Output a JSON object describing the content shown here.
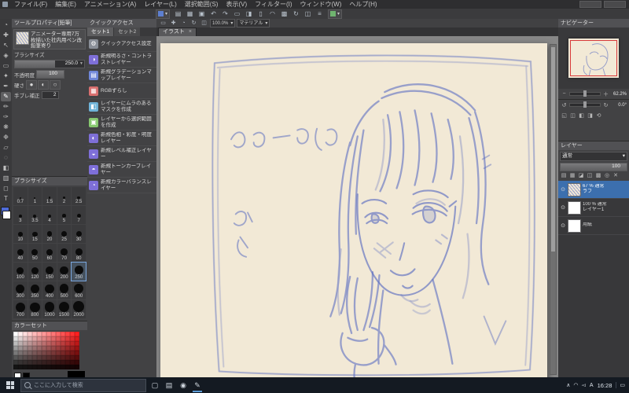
{
  "colors": {
    "selection_blue": "#3c6fae",
    "canvas_paper": "#f2e9d6",
    "sketch_blue": "#5d6fc1",
    "navigator_view_frame": "#d83a3a",
    "taskbar_bg": "#141a22"
  },
  "menu_bar": {
    "items": [
      {
        "label": "ファイル(F)"
      },
      {
        "label": "編集(E)"
      },
      {
        "label": "アニメーション(A)"
      },
      {
        "label": "レイヤー(L)"
      },
      {
        "label": "選択範囲(S)"
      },
      {
        "label": "表示(V)"
      },
      {
        "label": "フィルター(I)"
      },
      {
        "label": "ウィンドウ(W)"
      },
      {
        "label": "ヘルプ(H)"
      }
    ]
  },
  "command_bar": {
    "icons": [
      {
        "name": "new-file-icon",
        "glyph": "▤"
      },
      {
        "name": "open-file-icon",
        "glyph": "▦"
      },
      {
        "name": "save-file-icon",
        "glyph": "▣"
      },
      {
        "name": "undo-icon",
        "glyph": "↶"
      },
      {
        "name": "redo-icon",
        "glyph": "↷"
      },
      {
        "name": "deselect-icon",
        "glyph": "▭"
      },
      {
        "name": "invert-selection-icon",
        "glyph": "◨"
      },
      {
        "name": "selection-border-icon",
        "glyph": "▯"
      },
      {
        "name": "snap-ruler-icon",
        "glyph": "◠"
      },
      {
        "name": "snap-grid-icon",
        "glyph": "▩"
      },
      {
        "name": "rotate-view-icon",
        "glyph": "↻"
      },
      {
        "name": "flip-view-icon",
        "glyph": "◫"
      },
      {
        "name": "settings-icon",
        "glyph": "≡"
      }
    ]
  },
  "canvas_toolbar": {
    "icons": [
      {
        "name": "object-launcher-icon",
        "glyph": "▭"
      },
      {
        "name": "hand-view-icon",
        "glyph": "✚"
      },
      {
        "name": "zoom-view-icon",
        "glyph": "◔"
      },
      {
        "name": "rotate-view-icon",
        "glyph": "↻"
      },
      {
        "name": "flip-horizontal-icon",
        "glyph": "◫"
      }
    ],
    "zoom_value": "100.0%",
    "material_label": "マテリアル"
  },
  "tool_strip": {
    "tools": [
      {
        "name": "zoom-tool",
        "glyph": "◔",
        "selected": false
      },
      {
        "name": "move-tool",
        "glyph": "✚",
        "selected": false
      },
      {
        "name": "operation-tool",
        "glyph": "↖",
        "selected": false
      },
      {
        "name": "layer-move-tool",
        "glyph": "◈",
        "selected": false
      },
      {
        "name": "selection-tool",
        "glyph": "▭",
        "selected": false
      },
      {
        "name": "auto-select-tool",
        "glyph": "✦",
        "selected": false
      },
      {
        "name": "eyedropper-tool",
        "glyph": "✒",
        "selected": false
      },
      {
        "name": "pen-tool",
        "glyph": "✎",
        "selected": true
      },
      {
        "name": "pencil-tool",
        "glyph": "✏",
        "selected": false
      },
      {
        "name": "brush-tool",
        "glyph": "✑",
        "selected": false
      },
      {
        "name": "airbrush-tool",
        "glyph": "❋",
        "selected": false
      },
      {
        "name": "decoration-tool",
        "glyph": "❉",
        "selected": false
      },
      {
        "name": "eraser-tool",
        "glyph": "▱",
        "selected": false
      },
      {
        "name": "blend-tool",
        "glyph": "◌",
        "selected": false
      },
      {
        "name": "fill-tool",
        "glyph": "◧",
        "selected": false
      },
      {
        "name": "gradient-tool",
        "glyph": "▥",
        "selected": false
      },
      {
        "name": "figure-tool",
        "glyph": "◻",
        "selected": false
      },
      {
        "name": "text-tool",
        "glyph": "T",
        "selected": false
      }
    ],
    "foreground_color": "#4f6bd8",
    "background_color": "#ffffff"
  },
  "tool_property": {
    "title": "ツールプロパティ[鉛筆]",
    "tool_name": "アニメーター専用7万枚描いた社内用ペン改 鉛筆寄り",
    "brush_size_label": "ブラシサイズ",
    "brush_size_value": "250.0",
    "opacity_label": "不透明度",
    "opacity_value": "100",
    "hardness_label": "硬さ",
    "hardness_icons": [
      {
        "glyph": "●"
      },
      {
        "glyph": "◐"
      },
      {
        "glyph": "○"
      }
    ],
    "stabilization_label": "手ブレ補正",
    "stabilization_value": "2"
  },
  "brush_size_panel": {
    "title": "ブラシサイズ",
    "selected": "250",
    "rows": [
      [
        "0.7",
        "1",
        "1.5",
        "2",
        "2.5"
      ],
      [
        "3",
        "3.5",
        "4",
        "5",
        "7"
      ],
      [
        "10",
        "15",
        "20",
        "25",
        "30"
      ],
      [
        "40",
        "50",
        "60",
        "70",
        "80"
      ],
      [
        "100",
        "120",
        "150",
        "200",
        "250"
      ],
      [
        "300",
        "350",
        "400",
        "500",
        "600"
      ],
      [
        "700",
        "800",
        "1000",
        "1500",
        "2000"
      ]
    ]
  },
  "color_set_panel": {
    "title": "カラーセット",
    "rows": 8,
    "cols": 14,
    "top_left": "#ffffff",
    "top_right": "#ff2020",
    "footer_swatches": [
      "#ffffff",
      "#000000"
    ],
    "current_color": "#000000"
  },
  "quick_access": {
    "title": "クイックアクセス",
    "tabs": [
      {
        "label": "セット1",
        "active": true
      },
      {
        "label": "セット2",
        "active": false
      }
    ],
    "items": [
      {
        "name": "qa-quick-access-settings",
        "glyph": "⚙",
        "color": "#8a8f98",
        "label": "クイックアクセス設定"
      },
      {
        "name": "qa-new-brightness-contrast",
        "glyph": "◑",
        "color": "#7e6fd8",
        "label": "新規明るさ・コントラストレイヤー"
      },
      {
        "name": "qa-new-gradient-map",
        "glyph": "▤",
        "color": "#6f86d8",
        "label": "新規グラデーションマップレイヤー"
      },
      {
        "name": "qa-rgb-shift",
        "glyph": "▦",
        "color": "#d86f6f",
        "label": "RGBずらし"
      },
      {
        "name": "qa-uneven-mask",
        "glyph": "◧",
        "color": "#6fb3d8",
        "label": "レイヤーにムラのあるマスクを作成"
      },
      {
        "name": "qa-selection-from-layer",
        "glyph": "▣",
        "color": "#86c86f",
        "label": "レイヤーから選択範囲を作成"
      },
      {
        "name": "qa-new-hsl-layer",
        "glyph": "◐",
        "color": "#7e6fd8",
        "label": "新規色相・彩度・明度レイヤー"
      },
      {
        "name": "qa-new-level-layer",
        "glyph": "◒",
        "color": "#7e6fd8",
        "label": "新規レベル補正レイヤー"
      },
      {
        "name": "qa-new-tone-curve-layer",
        "glyph": "◓",
        "color": "#7e6fd8",
        "label": "新規トーンカーブレイヤー"
      },
      {
        "name": "qa-new-color-balance-layer",
        "glyph": "◔",
        "color": "#7e6fd8",
        "label": "新規カラーバランスレイヤー"
      }
    ]
  },
  "canvas": {
    "tab_label": "イラスト",
    "close_glyph": "×",
    "sketch_description": "青鉛筆ラフ：ピースサインをする女の子のバストアップ",
    "handwritten_texts": [
      "ふぉーあした",
      "か",
      "と"
    ]
  },
  "navigator": {
    "title": "ナビゲーター",
    "zoom_value": "62.2%",
    "rotation_value": "0.0°"
  },
  "layer_panel": {
    "title": "レイヤー",
    "blend_mode": "通常",
    "opacity_value": "100",
    "toolbar_icons": [
      {
        "name": "new-layer-icon",
        "glyph": "▤"
      },
      {
        "name": "new-folder-icon",
        "glyph": "▦"
      },
      {
        "name": "clip-to-layer-icon",
        "glyph": "◪"
      },
      {
        "name": "lock-layer-icon",
        "glyph": "◫"
      },
      {
        "name": "lock-transparent-icon",
        "glyph": "▩"
      },
      {
        "name": "set-as-reference-icon",
        "glyph": "◎"
      },
      {
        "name": "delete-layer-icon",
        "glyph": "✕"
      }
    ],
    "layers": [
      {
        "thumb": "sketch",
        "info": "67 % 通常",
        "name": "ラフ",
        "selected": true
      },
      {
        "thumb": "white",
        "info": "100 % 通常",
        "name": "レイヤー1",
        "selected": false
      },
      {
        "thumb": "paper",
        "info": "",
        "name": "用紙",
        "selected": false
      }
    ]
  },
  "taskbar": {
    "search_placeholder": "ここに入力して検索",
    "app_icons": [
      {
        "name": "task-view-icon",
        "glyph": "▢",
        "running": false
      },
      {
        "name": "explorer-icon",
        "glyph": "▤",
        "running": false
      },
      {
        "name": "browser-icon",
        "glyph": "◉",
        "running": false
      },
      {
        "name": "clip-studio-icon",
        "glyph": "✎",
        "running": true
      }
    ],
    "tray_icons": [
      {
        "name": "chevron-up-icon",
        "glyph": "∧"
      },
      {
        "name": "network-icon",
        "glyph": "◠"
      },
      {
        "name": "speaker-icon",
        "glyph": "◅"
      }
    ],
    "ime_indicator": "A",
    "time": "16:28",
    "notification_glyph": "▭"
  }
}
